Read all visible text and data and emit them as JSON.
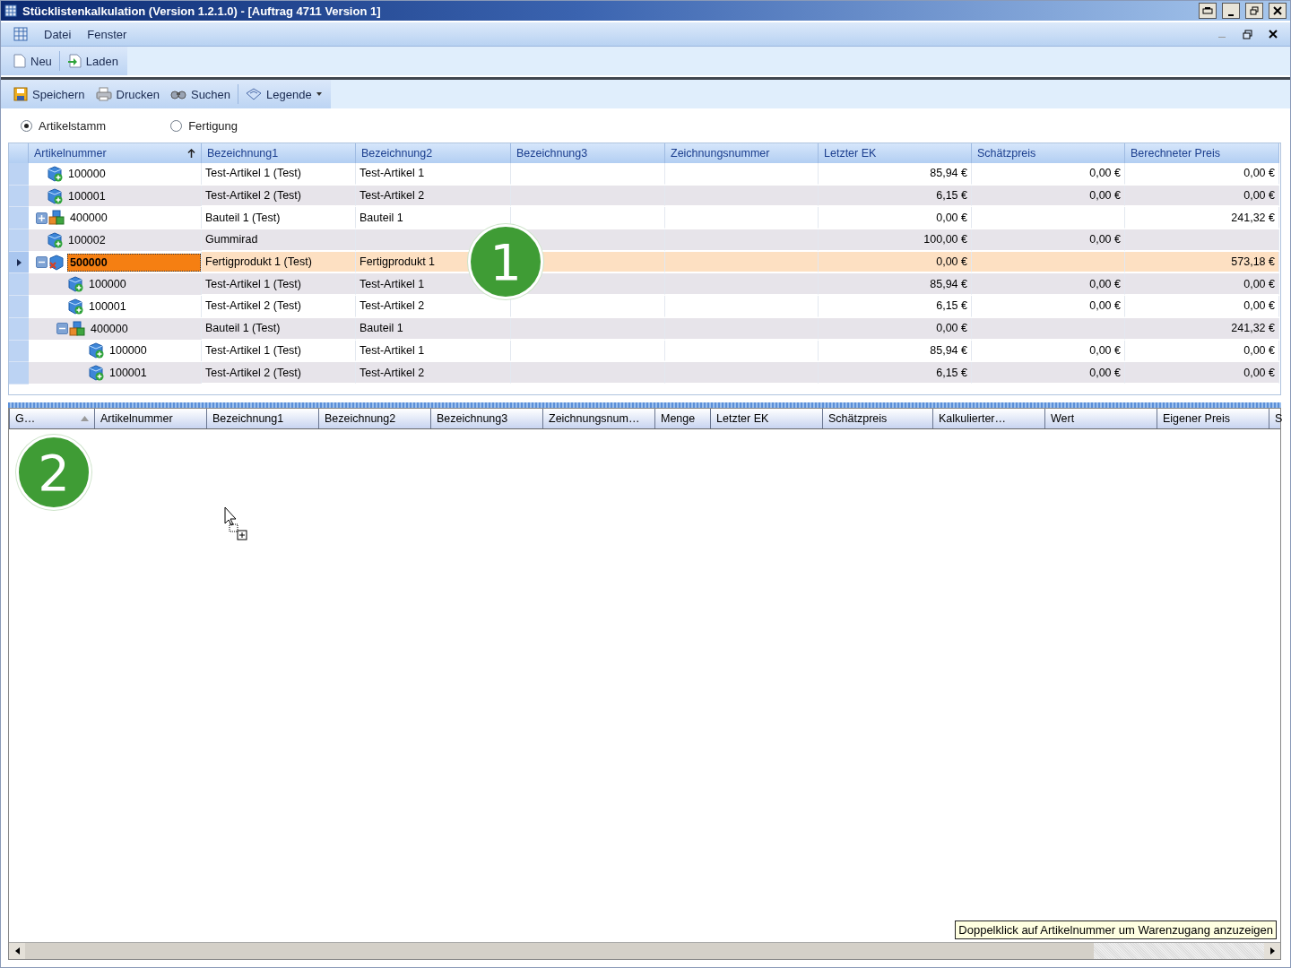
{
  "window": {
    "title": "Stücklistenkalkulation (Version 1.2.1.0) - [Auftrag 4711 Version 1]"
  },
  "menu": [
    "Datei",
    "Fenster"
  ],
  "toolbar_top": [
    {
      "kind": "new",
      "label": "Neu"
    },
    {
      "kind": "load",
      "label": "Laden"
    }
  ],
  "toolbar": [
    {
      "kind": "save",
      "label": "Speichern"
    },
    {
      "kind": "print",
      "label": "Drucken"
    },
    {
      "kind": "search",
      "label": "Suchen"
    },
    {
      "kind": "legend",
      "label": "Legende"
    }
  ],
  "source": [
    {
      "label": "Artikelstamm",
      "selected": true
    },
    {
      "label": "Fertigung",
      "selected": false
    }
  ],
  "grid": {
    "columns": [
      {
        "label": "Artikelnummer",
        "sorted": true
      },
      {
        "label": "Bezeichnung1",
        "sorted": false
      },
      {
        "label": "Bezeichnung2",
        "sorted": false
      },
      {
        "label": "Bezeichnung3",
        "sorted": false
      },
      {
        "label": "Zeichnungsnummer",
        "sorted": false
      },
      {
        "label": "Letzter EK",
        "sorted": false
      },
      {
        "label": "Schätzpreis",
        "sorted": false
      },
      {
        "label": "Berechneter Preis",
        "sorted": false
      }
    ],
    "rows": [
      {
        "kind": "article",
        "selected": false,
        "cells": [
          "100000",
          "Test-Artikel 1  (Test)",
          "Test-Artikel 1",
          "",
          "",
          "85,94 €",
          "0,00 €",
          "0,00 €"
        ]
      },
      {
        "kind": "article",
        "selected": false,
        "cells": [
          "100001",
          "Test-Artikel 2  (Test)",
          "Test-Artikel 2",
          "",
          "",
          "6,15 €",
          "0,00 €",
          "0,00 €"
        ]
      },
      {
        "kind": "assembly",
        "selected": false,
        "expanded": false,
        "cells": [
          "400000",
          "Bauteil 1  (Test)",
          "Bauteil 1",
          "",
          "",
          "0,00 €",
          "",
          "241,32 €"
        ]
      },
      {
        "kind": "article",
        "selected": false,
        "cells": [
          "100002",
          "Gummirad",
          "",
          "",
          "",
          "100,00 €",
          "0,00 €",
          ""
        ]
      },
      {
        "kind": "product",
        "selected": true,
        "expanded": true,
        "cells": [
          "500000",
          "Fertigprodukt 1  (Test)",
          "Fertigprodukt 1",
          "",
          "",
          "0,00 €",
          "",
          "573,18 €"
        ],
        "children": [
          {
            "kind": "article",
            "selected": false,
            "cells": [
              "100000",
              "Test-Artikel 1  (Test)",
              "Test-Artikel 1",
              "",
              "",
              "85,94 €",
              "0,00 €",
              "0,00 €"
            ]
          },
          {
            "kind": "article",
            "selected": false,
            "cells": [
              "100001",
              "Test-Artikel 2  (Test)",
              "Test-Artikel 2",
              "",
              "",
              "6,15 €",
              "0,00 €",
              "0,00 €"
            ]
          },
          {
            "kind": "assembly",
            "selected": false,
            "expanded": true,
            "cells": [
              "400000",
              "Bauteil 1  (Test)",
              "Bauteil 1",
              "",
              "",
              "0,00 €",
              "",
              "241,32 €"
            ],
            "children": [
              {
                "kind": "article",
                "selected": false,
                "cells": [
                  "100000",
                  "Test-Artikel 1  (Test)",
                  "Test-Artikel 1",
                  "",
                  "",
                  "85,94 €",
                  "0,00 €",
                  "0,00 €"
                ]
              },
              {
                "kind": "article",
                "selected": false,
                "cells": [
                  "100001",
                  "Test-Artikel 2  (Test)",
                  "Test-Artikel 2",
                  "",
                  "",
                  "6,15 €",
                  "0,00 €",
                  "0,00 €"
                ]
              }
            ]
          }
        ]
      }
    ]
  },
  "lower_grid": {
    "columns": [
      {
        "label": "G…",
        "sorted": true
      },
      {
        "label": "Artikelnummer",
        "sorted": false
      },
      {
        "label": "Bezeichnung1",
        "sorted": false
      },
      {
        "label": "Bezeichnung2",
        "sorted": false
      },
      {
        "label": "Bezeichnung3",
        "sorted": false
      },
      {
        "label": "Zeichnungsnum…",
        "sorted": false
      },
      {
        "label": "Menge",
        "sorted": false
      },
      {
        "label": "Letzter EK",
        "sorted": false
      },
      {
        "label": "Schätzpreis",
        "sorted": false
      },
      {
        "label": "Kalkulierter…",
        "sorted": false
      },
      {
        "label": "Wert",
        "sorted": false
      },
      {
        "label": "Eigener Preis",
        "sorted": false
      },
      {
        "label": "S",
        "sorted": false
      }
    ]
  },
  "callouts": [
    "1",
    "2"
  ],
  "tooltip": "Doppelklick auf Artikelnummer um Warenzugang anzuzeigen"
}
